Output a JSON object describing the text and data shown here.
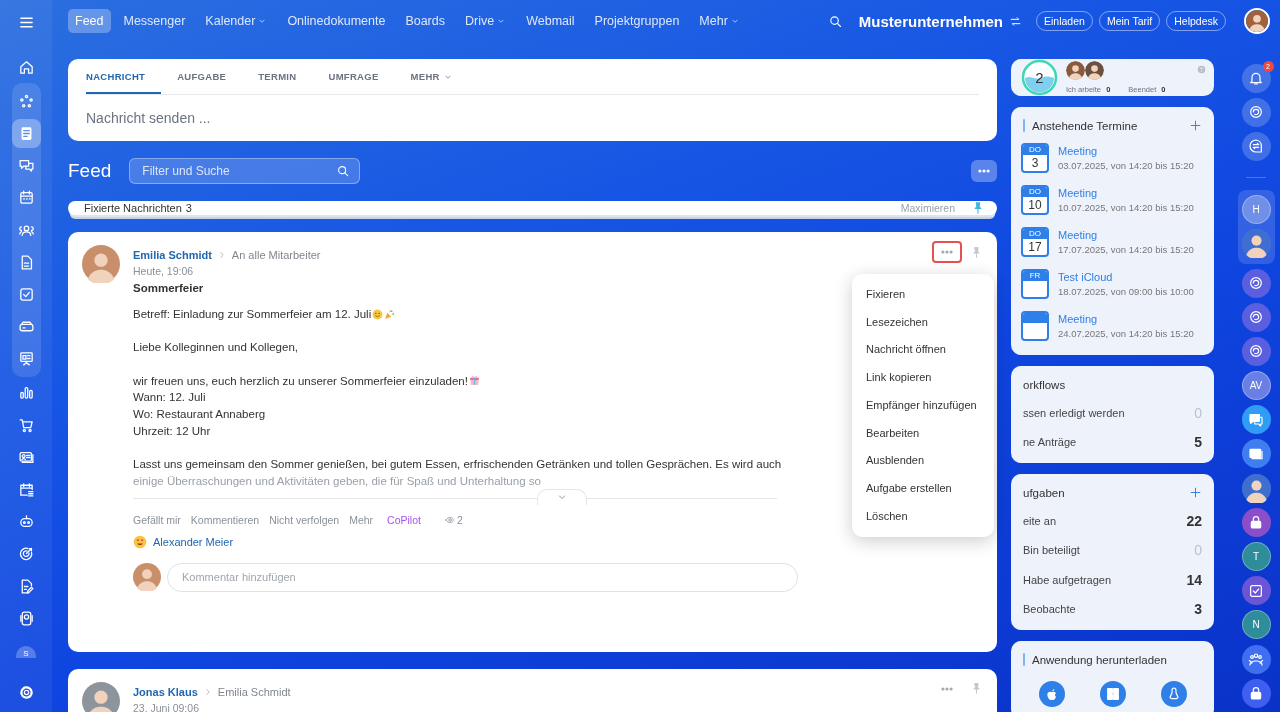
{
  "sidebar": {
    "top": [
      {
        "kind": "home",
        "selected": false
      }
    ],
    "group": [
      {
        "kind": "pulse",
        "selected": false
      },
      {
        "kind": "news",
        "selected": true
      },
      {
        "kind": "chat",
        "selected": false
      },
      {
        "kind": "calendar",
        "selected": false
      },
      {
        "kind": "people",
        "selected": false
      },
      {
        "kind": "doc",
        "selected": false
      },
      {
        "kind": "check",
        "selected": false
      },
      {
        "kind": "drive",
        "selected": false
      },
      {
        "kind": "board",
        "selected": false
      }
    ],
    "rest": [
      {
        "kind": "chart",
        "selected": false
      },
      {
        "kind": "cart",
        "selected": false
      },
      {
        "kind": "cards",
        "selected": false
      },
      {
        "kind": "callist",
        "selected": false
      },
      {
        "kind": "robot",
        "selected": false
      },
      {
        "kind": "target",
        "selected": false
      },
      {
        "kind": "docedit",
        "selected": false
      },
      {
        "kind": "device",
        "selected": false
      }
    ],
    "user_initial": "S"
  },
  "topbar": {
    "nav": [
      {
        "label": "Feed",
        "selected": true,
        "dropdown": false
      },
      {
        "label": "Messenger",
        "selected": false,
        "dropdown": false
      },
      {
        "label": "Kalender",
        "selected": false,
        "dropdown": true
      },
      {
        "label": "Onlinedokumente",
        "selected": false,
        "dropdown": false
      },
      {
        "label": "Boards",
        "selected": false,
        "dropdown": false
      },
      {
        "label": "Drive",
        "selected": false,
        "dropdown": true
      },
      {
        "label": "Webmail",
        "selected": false,
        "dropdown": false
      },
      {
        "label": "Projektgruppen",
        "selected": false,
        "dropdown": false
      },
      {
        "label": "Mehr",
        "selected": false,
        "dropdown": true
      }
    ],
    "company": "Musterunternehmen",
    "buttons": [
      "Einladen",
      "Mein Tarif",
      "Helpdesk"
    ]
  },
  "composer": {
    "tabs": [
      {
        "label": "NACHRICHT",
        "selected": true,
        "dropdown": false
      },
      {
        "label": "AUFGABE",
        "selected": false,
        "dropdown": false
      },
      {
        "label": "TERMIN",
        "selected": false,
        "dropdown": false
      },
      {
        "label": "UMFRAGE",
        "selected": false,
        "dropdown": false
      },
      {
        "label": "MEHR",
        "selected": false,
        "dropdown": true
      }
    ],
    "placeholder": "Nachricht senden ..."
  },
  "feed": {
    "title": "Feed",
    "filter_placeholder": "Filter und Suche"
  },
  "pinned": {
    "label": "Fixierte Nachrichten",
    "count": "3",
    "action": "Maximieren"
  },
  "posts": [
    {
      "author": "Emilia Schmidt",
      "recipient": "An alle Mitarbeiter",
      "time": "Heute, 19:06",
      "title": "Sommerfeier",
      "menu_open": true,
      "paragraphs": [
        [
          {
            "text": "Betreff: Einladung zur Sommerfeier am 12. Juli",
            "kind": "celebrate"
          }
        ],
        [
          {
            "text": "Liebe Kolleginnen und Kollegen,",
            "kind": "plain"
          }
        ],
        [
          {
            "text": "wir freuen uns, euch herzlich zu unserer Sommerfeier einzuladen!",
            "kind": "gift"
          },
          {
            "text": "Wann: 12. Juli",
            "kind": "plain"
          },
          {
            "text": "Wo: Restaurant Annaberg",
            "kind": "plain"
          },
          {
            "text": "Uhrzeit: 12 Uhr",
            "kind": "plain"
          }
        ],
        [
          {
            "text": "Lasst uns gemeinsam den Sommer genießen, bei gutem Essen, erfrischenden Getränken und tollen Gesprächen. Es wird auch",
            "kind": "plain"
          },
          {
            "text": "einige Überraschungen und Aktivitäten geben, die für Spaß und Unterhaltung so",
            "kind": "plain"
          }
        ]
      ],
      "actions": [
        {
          "label": "Gefällt mir",
          "kind": "plain"
        },
        {
          "label": "Kommentieren",
          "kind": "plain"
        },
        {
          "label": "Nicht verfolgen",
          "kind": "plain"
        },
        {
          "label": "Mehr",
          "kind": "plain"
        },
        {
          "label": "CoPilot",
          "kind": "copilot"
        }
      ],
      "views": "2",
      "reaction_user": "Alexander Meier",
      "comment_placeholder": "Kommentar hinzufügen"
    },
    {
      "author": "Jonas Klaus",
      "recipient": "Emilia Schmidt",
      "time": "23. Juni 09:06",
      "menu_open": false
    }
  ],
  "menu": {
    "items": [
      "Fixieren",
      "Lesezeichen",
      "Nachricht öffnen",
      "Link kopieren",
      "Empfänger hinzufügen",
      "Bearbeiten",
      "Ausblenden",
      "Aufgabe erstellen",
      "Löschen"
    ]
  },
  "right": {
    "timeman": {
      "count": "2",
      "stats": [
        {
          "label": "Ich arbeite",
          "value": "0"
        },
        {
          "label": "Beendet",
          "value": "0"
        }
      ]
    },
    "events": {
      "title": "Anstehende Termine",
      "items": [
        {
          "weekday": "DO",
          "day": "3",
          "title": "Meeting",
          "when": "03.07.2025, von 14:20 bis 15:20"
        },
        {
          "weekday": "DO",
          "day": "10",
          "title": "Meeting",
          "when": "10.07.2025, von 14:20 bis 15:20"
        },
        {
          "weekday": "DO",
          "day": "17",
          "title": "Meeting",
          "when": "17.07.2025, von 14:20 bis 15:20"
        },
        {
          "weekday": "FR",
          "title": "Test iCloud",
          "when": "18.07.2025, von 09:00 bis 10:00"
        },
        {
          "title": "Meeting",
          "when": "24.07.2025, von 14:20 bis 15:20"
        }
      ]
    },
    "workflows": {
      "title": "orkflows",
      "rows": [
        {
          "label": "ssen erledigt werden",
          "value": "0",
          "dim": true
        },
        {
          "label": "ne Anträge",
          "value": "5",
          "dim": false
        }
      ]
    },
    "tasks": {
      "title": "ufgaben",
      "rows": [
        {
          "label": "eite an",
          "value": "22",
          "dim": false
        },
        {
          "label": "Bin beteiligt",
          "value": "0",
          "dim": true
        },
        {
          "label": "Habe aufgetragen",
          "value": "14",
          "dim": false
        },
        {
          "label": "Beobachte",
          "value": "3",
          "dim": false
        }
      ]
    },
    "download": {
      "title": "Anwendung herunterladen"
    }
  },
  "rail": {
    "top": [
      {
        "kind": "bell",
        "badge": "2"
      },
      {
        "kind": "swirl"
      },
      {
        "kind": "swapchat"
      }
    ],
    "group": [
      {
        "kind": "letter",
        "text": "H",
        "color": "#6f8fe8"
      },
      {
        "kind": "photo"
      }
    ],
    "rest": [
      {
        "kind": "swirl",
        "color": "#5a5fe0"
      },
      {
        "kind": "swirl",
        "color": "#5a5fe0"
      },
      {
        "kind": "swirl",
        "color": "#5a5fe0"
      },
      {
        "kind": "letter",
        "text": "AV",
        "color": "#6a7fe6"
      },
      {
        "kind": "bubble",
        "color": "#2f9cf5"
      },
      {
        "kind": "card",
        "color": "#3f7ef0"
      },
      {
        "kind": "photo"
      },
      {
        "kind": "lock",
        "color": "#8a4fc8"
      },
      {
        "kind": "letter",
        "text": "T",
        "color": "#2f8c9a"
      },
      {
        "kind": "boardcheck",
        "color": "#6a55d6"
      },
      {
        "kind": "letter",
        "text": "N",
        "color": "#2f8c9a"
      },
      {
        "kind": "group",
        "color": "#3f6ff0"
      },
      {
        "kind": "lock",
        "color": "#3f5ff0"
      }
    ]
  }
}
